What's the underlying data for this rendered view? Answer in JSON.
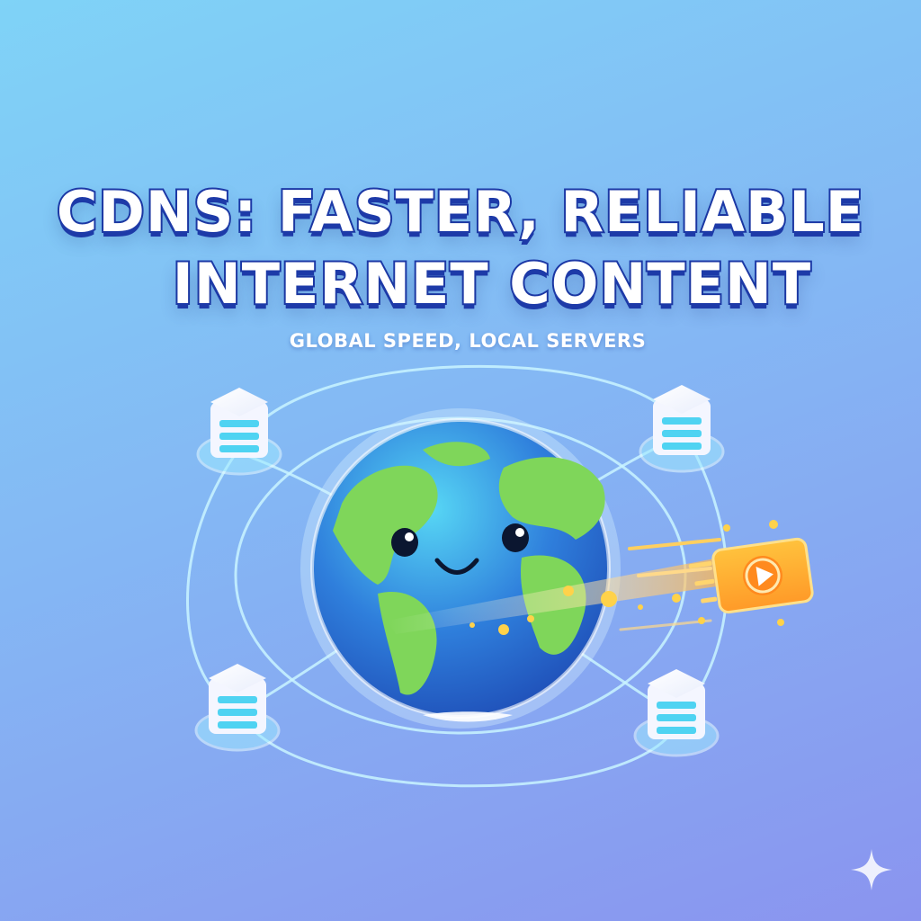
{
  "title": {
    "line1": "CDNS: FASTER, RELIABLE",
    "line2": "INTERNET CONTENT"
  },
  "subtitle": "GLOBAL SPEED, LOCAL SERVERS",
  "icons": [
    "server-icon",
    "globe-icon",
    "play-icon",
    "sparkle-icon"
  ],
  "colors": {
    "background_top": "#7fd3f7",
    "background_bottom": "#8a94ef",
    "title_text": "#ffffff",
    "title_outline": "#1d3aa8",
    "ocean": "#2f7fdc",
    "land": "#7fd65a",
    "play_card": "#ffab2e",
    "network_line": "#bff0ff"
  }
}
